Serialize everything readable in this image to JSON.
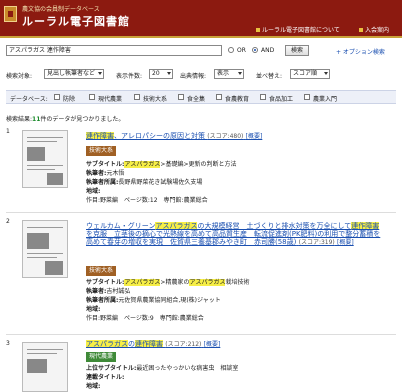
{
  "header": {
    "subtitle": "農文協の会員制データベース",
    "title": "ルーラル電子図書館",
    "link_about": "ルーラル電子図書館について",
    "link_join": "入会案内"
  },
  "search": {
    "query": "アスパラガス 連作障害",
    "or_label": "OR",
    "and_label": "AND",
    "search_button": "検索",
    "option_link": "+ オプション検索"
  },
  "options": {
    "target_label": "検索対象:",
    "target_value": "見出し執筆者など",
    "count_label": "表示件数:",
    "count_value": "20",
    "source_label": "出典情報:",
    "source_value": "表示",
    "sort_label": "並べ替え:",
    "sort_value": "スコア順"
  },
  "databases": {
    "label": "データベース:",
    "items": [
      "防除",
      "現代農業",
      "技術大系",
      "食全集",
      "食農教育",
      "食品加工",
      "農業入門"
    ]
  },
  "result_count": {
    "prefix": "検索結果:",
    "num": "11",
    "suffix": "件のデータが見つかりました。"
  },
  "results": [
    {
      "num": "1",
      "title_hl1": "連作障害",
      "title_rest": "、アレロパシーの原因と対策",
      "score": "(スコア:480)",
      "gaiyo": "[概要]",
      "badge": "技術大系",
      "sub_label": "サブタイトル:",
      "sub_hl": "アスパラガス",
      "sub_rest": ">基礎編>更新の判断と方法",
      "author_label": "執筆者:",
      "author": "元木悟",
      "affil_label": "執筆者所属:",
      "affil": "長野県野菜花き試験場佐久支場",
      "place_label": "地域:",
      "place": "",
      "meta_line": "作目:野菜編　ページ数:12　専門館:農業総合"
    },
    {
      "num": "2",
      "title_p1": "ウェルカム・グリーン",
      "title_hl1": "アスパラガス",
      "title_p2": "の大規模経営　土づくりと排水対策を万全にして",
      "title_hl2": "連作障害",
      "title_p3": "を克服　立茎後の摘心で光熱線を高めて高品質生産　転流促進剤(PK肥料)の利用で整分蓄積を高めて春芽の増収を実現　佐賀県三養基郡みやき町　赤司勝(58歳)",
      "score": "(スコア:319)",
      "gaiyo": "[概要]",
      "badge": "技術大系",
      "sub_label": "サブタイトル:",
      "sub_hl": "アスパラガス",
      "sub_rest": ">精農家の",
      "sub_hl2": "アスパラガス",
      "sub_rest2": "栽培技術",
      "author_label": "執筆者:",
      "author": "吉村誠弘",
      "affil_label": "執筆者所属:",
      "affil": "元佐賀県農業協同組合,現(株)ジャット",
      "place_label": "地域:",
      "place": "",
      "meta_line": "作目:野菜編　ページ数:9　専門館:農業総合"
    },
    {
      "num": "3",
      "title_hl1": "アスパラガス",
      "title_rest": "の",
      "title_hl2": "連作障害",
      "score": "(スコア:212)",
      "gaiyo": "[概要]",
      "badge": "現代農業",
      "sub_label": "上位サブタイトル:",
      "sub": "最近困ったやっかいな病害虫　相談室",
      "linked_label": "連載タイトル:",
      "linked": "",
      "place_label": "地域:",
      "place": ""
    }
  ],
  "colors": {
    "header_bg": "#8c1a10",
    "link": "#1a4fb0",
    "highlight": "#f6ee46",
    "badge_taikei": "#a06024",
    "badge_gendai": "#3f8a38"
  }
}
